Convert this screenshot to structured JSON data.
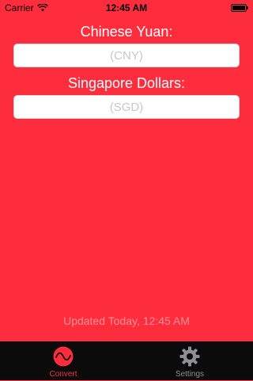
{
  "status_bar": {
    "carrier": "Carrier",
    "time": "12:45 AM"
  },
  "fields": {
    "cny": {
      "label": "Chinese Yuan:",
      "placeholder": "(CNY)",
      "value": ""
    },
    "sgd": {
      "label": "Singapore Dollars:",
      "placeholder": "(SGD)",
      "value": ""
    }
  },
  "footer": {
    "updated": "Updated Today, 12:45 AM"
  },
  "tab_bar": {
    "tabs": [
      {
        "label": "Convert",
        "icon": "convert-wave-icon",
        "selected": true
      },
      {
        "label": "Settings",
        "icon": "gear-icon",
        "selected": false
      }
    ]
  },
  "colors": {
    "background": "#fe2d3d",
    "tab_bar": "#0b0b0b",
    "tab_active": "#fe2d3d",
    "tab_inactive": "#8e8e93",
    "updated_text": "#ff8f97"
  }
}
